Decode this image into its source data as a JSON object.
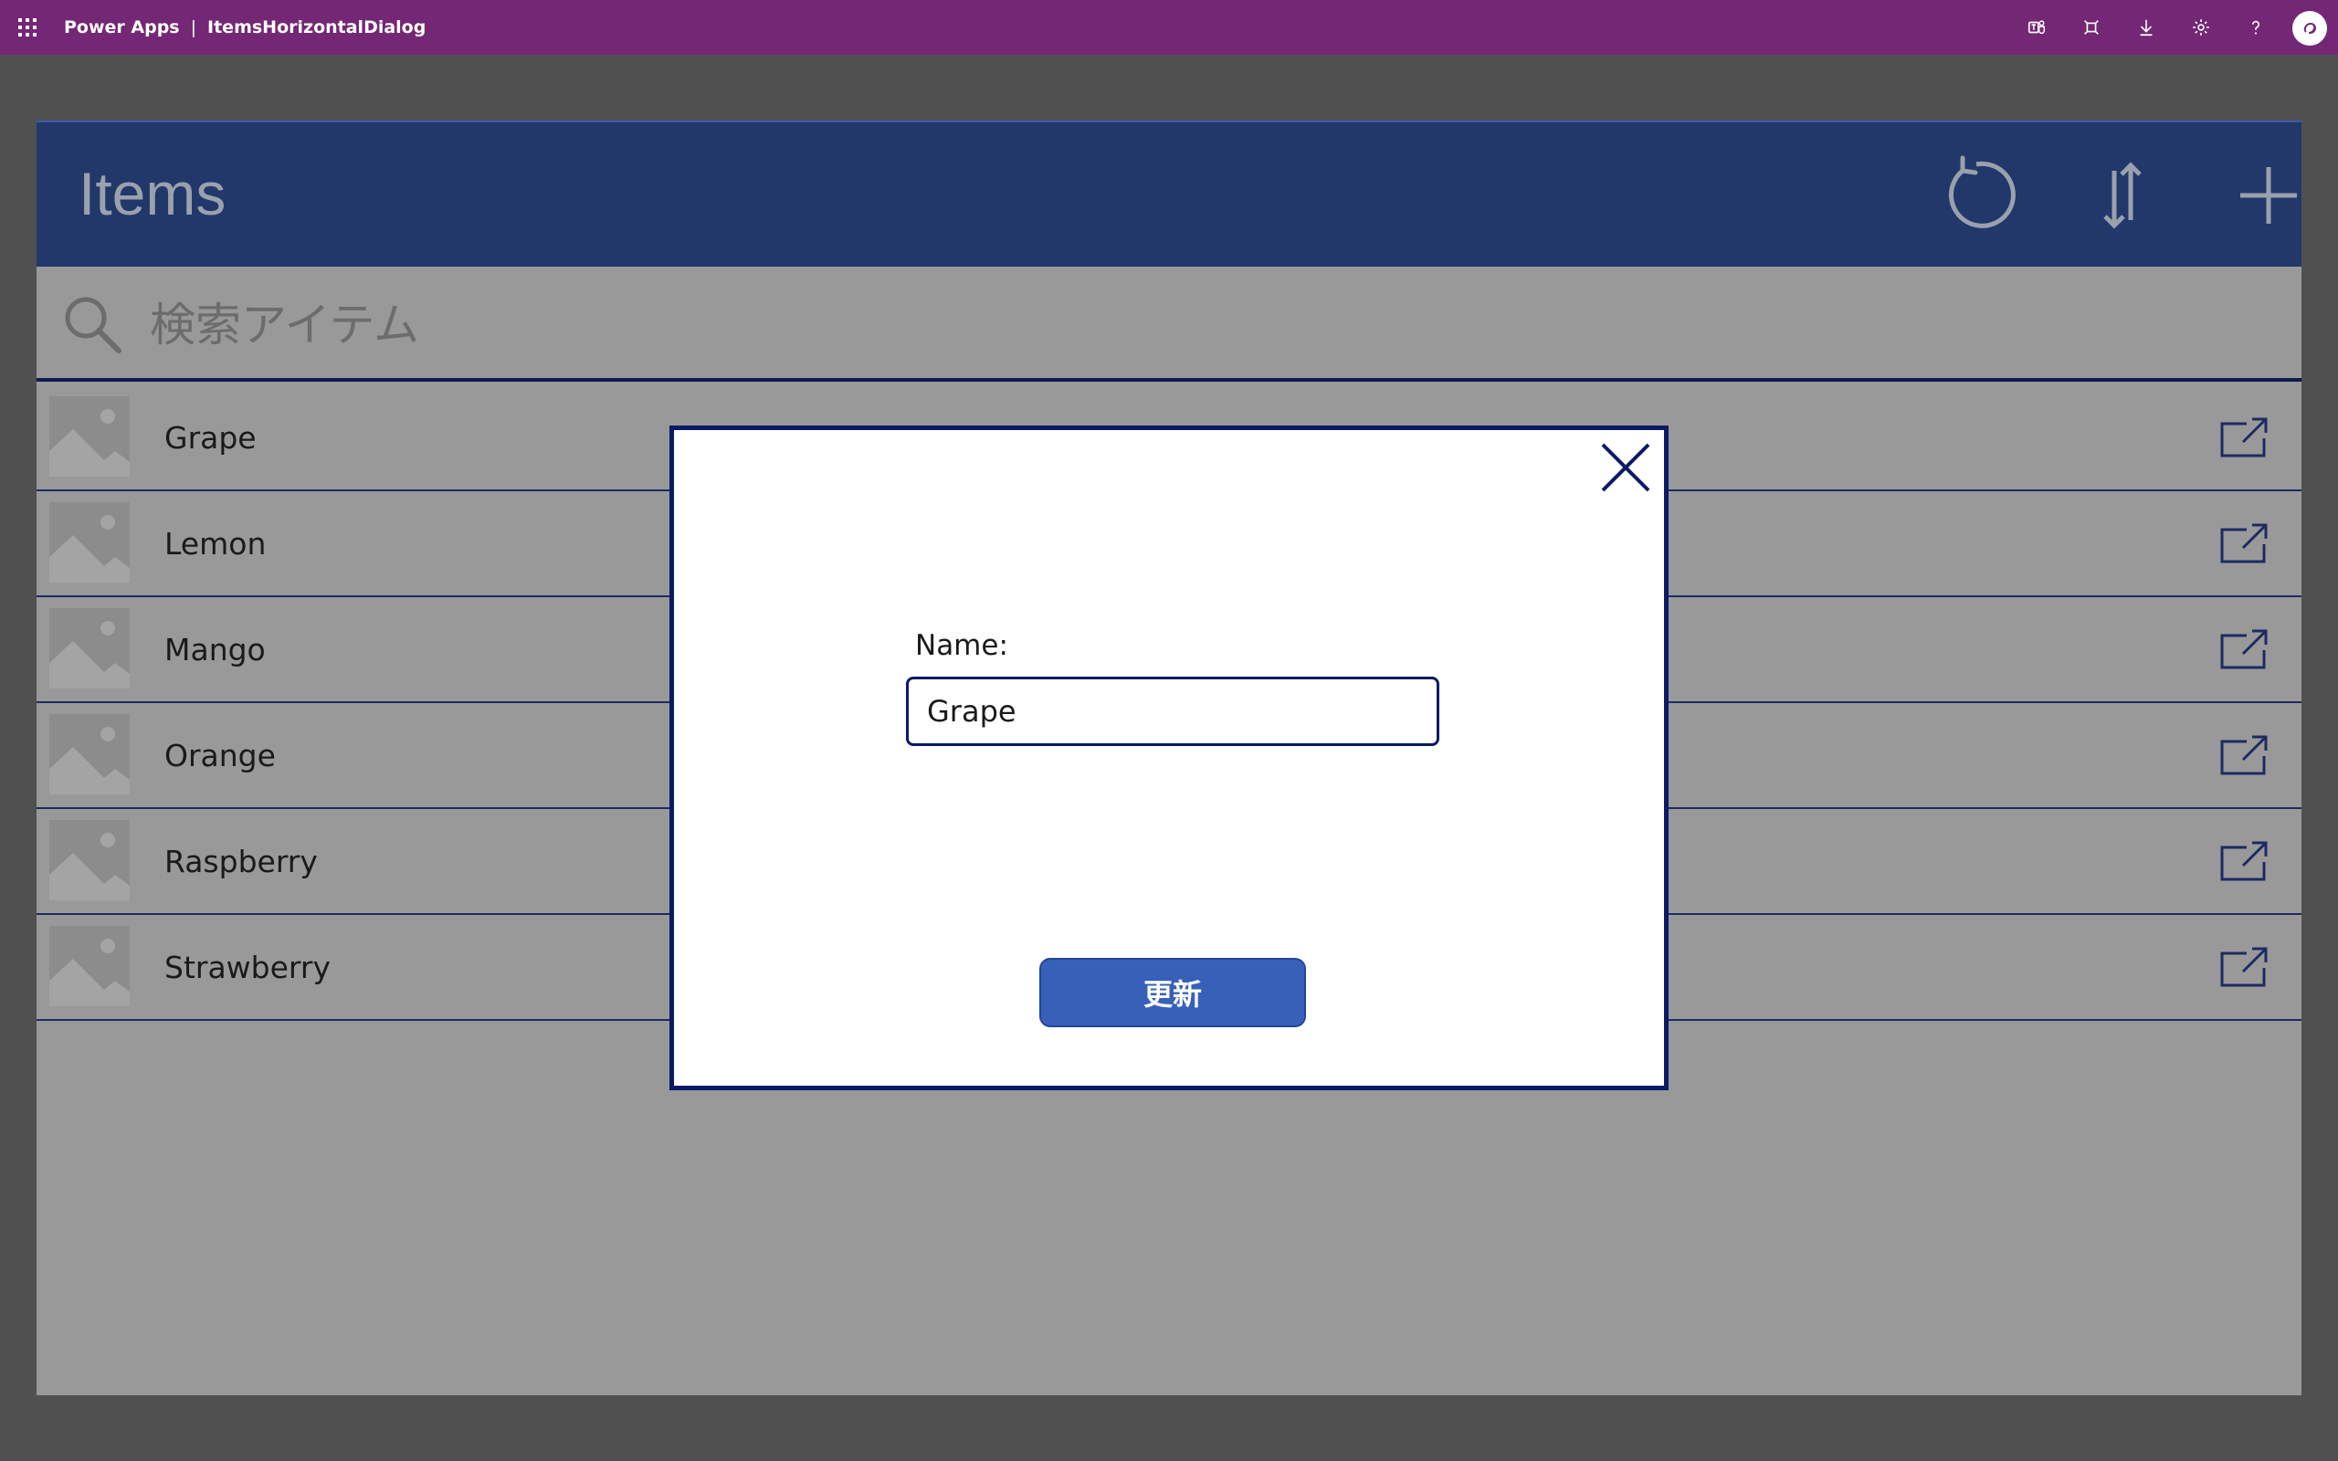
{
  "topbar": {
    "app_name": "Power Apps",
    "separator": "|",
    "doc_name": "ItemsHorizontalDialog",
    "icons": [
      "waffle-icon",
      "teams-icon",
      "fit-screen-icon",
      "download-icon",
      "settings-icon",
      "help-icon",
      "copilot-avatar-icon"
    ]
  },
  "header": {
    "title": "Items",
    "buttons": [
      "refresh-icon",
      "sort-icon",
      "add-icon"
    ]
  },
  "search": {
    "placeholder": "検索アイテム",
    "value": ""
  },
  "list": {
    "items": [
      {
        "label": "Grape"
      },
      {
        "label": "Lemon"
      },
      {
        "label": "Mango"
      },
      {
        "label": "Orange"
      },
      {
        "label": "Raspberry"
      },
      {
        "label": "Strawberry"
      }
    ]
  },
  "dialog": {
    "name_label": "Name:",
    "name_value": "Grape",
    "update_label": "更新"
  },
  "colors": {
    "suite_bar": "#742774",
    "header": "#22386b",
    "accent": "#0b1a66",
    "button": "#3860b8",
    "overlay": "#999999"
  }
}
